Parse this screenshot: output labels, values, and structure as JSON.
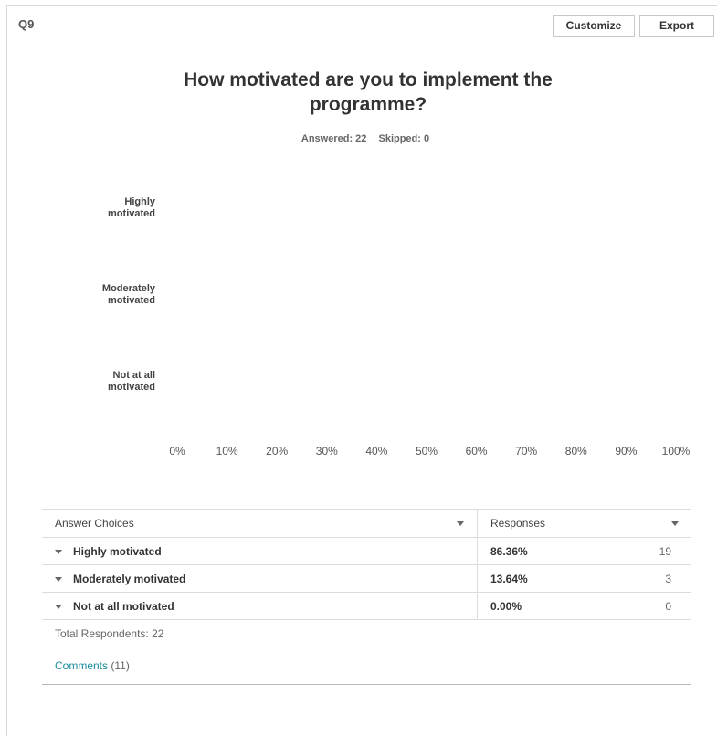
{
  "question": {
    "number": "Q9",
    "title": "How motivated are you to implement the programme?",
    "answered_label": "Answered: 22",
    "skipped_label": "Skipped: 0"
  },
  "toolbar": {
    "customize_label": "Customize",
    "export_label": "Export"
  },
  "chart_data": {
    "type": "bar",
    "orientation": "horizontal",
    "categories": [
      "Highly motivated",
      "Moderately motivated",
      "Not at all motivated"
    ],
    "category_lines": [
      [
        "Highly",
        "motivated"
      ],
      [
        "Moderately",
        "motivated"
      ],
      [
        "Not at all",
        "motivated"
      ]
    ],
    "values": [
      86.36,
      13.64,
      0.0
    ],
    "xlim": [
      0,
      100
    ],
    "x_ticks": [
      "0%",
      "10%",
      "20%",
      "30%",
      "40%",
      "50%",
      "60%",
      "70%",
      "80%",
      "90%",
      "100%"
    ],
    "bars_rendered": false,
    "grid": false
  },
  "table": {
    "headers": {
      "answer_choices": "Answer Choices",
      "responses": "Responses"
    },
    "rows": [
      {
        "choice": "Highly motivated",
        "percent": "86.36%",
        "count": "19"
      },
      {
        "choice": "Moderately motivated",
        "percent": "13.64%",
        "count": "3"
      },
      {
        "choice": "Not at all motivated",
        "percent": "0.00%",
        "count": "0"
      }
    ],
    "total_respondents": "Total Respondents: 22",
    "comments_label": "Comments",
    "comments_count": "(11)"
  }
}
